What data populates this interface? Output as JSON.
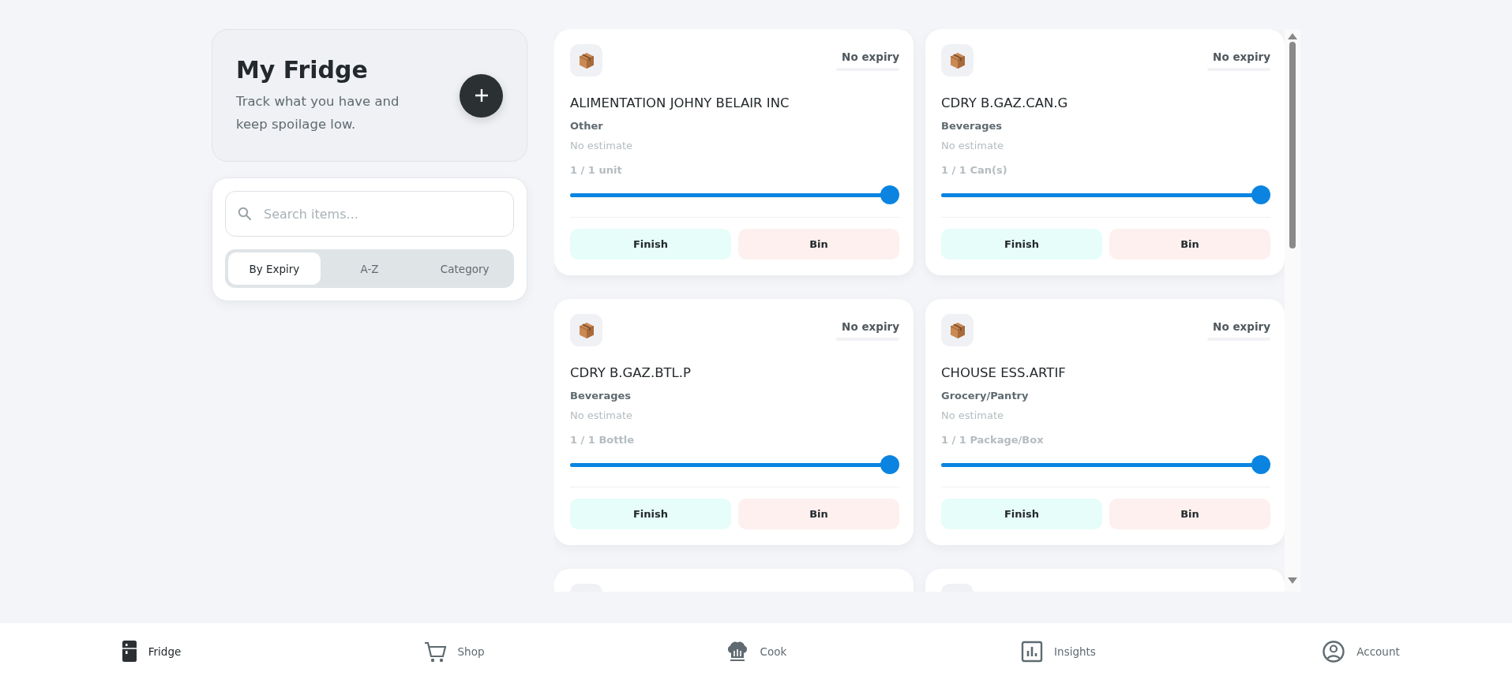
{
  "header": {
    "title": "My Fridge",
    "subtitle": "Track what you have and keep spoilage low."
  },
  "search": {
    "placeholder": "Search items..."
  },
  "sort_tabs": [
    {
      "label": "By Expiry",
      "selected": true
    },
    {
      "label": "A-Z",
      "selected": false
    },
    {
      "label": "Category",
      "selected": false
    }
  ],
  "items": [
    {
      "kind": "card",
      "name": "ALIMENTATION JOHNY BELAIR INC",
      "category": "Other",
      "estimate": "No estimate",
      "expiry": "No expiry",
      "quantity": "1 / 1 unit",
      "level": 1,
      "actions": [
        "Finish",
        "Bin"
      ]
    },
    {
      "kind": "card",
      "name": "CDRY B.GAZ.CAN.G",
      "category": "Beverages",
      "estimate": "No estimate",
      "expiry": "No expiry",
      "quantity": "1 / 1 Can(s)",
      "level": 1,
      "actions": [
        "Finish",
        "Bin"
      ]
    },
    {
      "kind": "card",
      "name": "CDRY B.GAZ.BTL.P",
      "category": "Beverages",
      "estimate": "No estimate",
      "expiry": "No expiry",
      "quantity": "1 / 1 Bottle",
      "level": 1,
      "actions": [
        "Finish",
        "Bin"
      ]
    },
    {
      "kind": "card",
      "name": "CHOUSE ESS.ARTIF",
      "category": "Grocery/Pantry",
      "estimate": "No estimate",
      "expiry": "No expiry",
      "quantity": "1 / 1 Package/Box",
      "level": 1,
      "actions": [
        "Finish",
        "Bin"
      ]
    },
    {
      "kind": "partial"
    },
    {
      "kind": "partial"
    }
  ],
  "nav": [
    {
      "label": "Fridge",
      "selected": true
    },
    {
      "label": "Shop",
      "selected": false
    },
    {
      "label": "Cook",
      "selected": false
    },
    {
      "label": "Insights",
      "selected": false
    },
    {
      "label": "Account",
      "selected": false
    }
  ]
}
